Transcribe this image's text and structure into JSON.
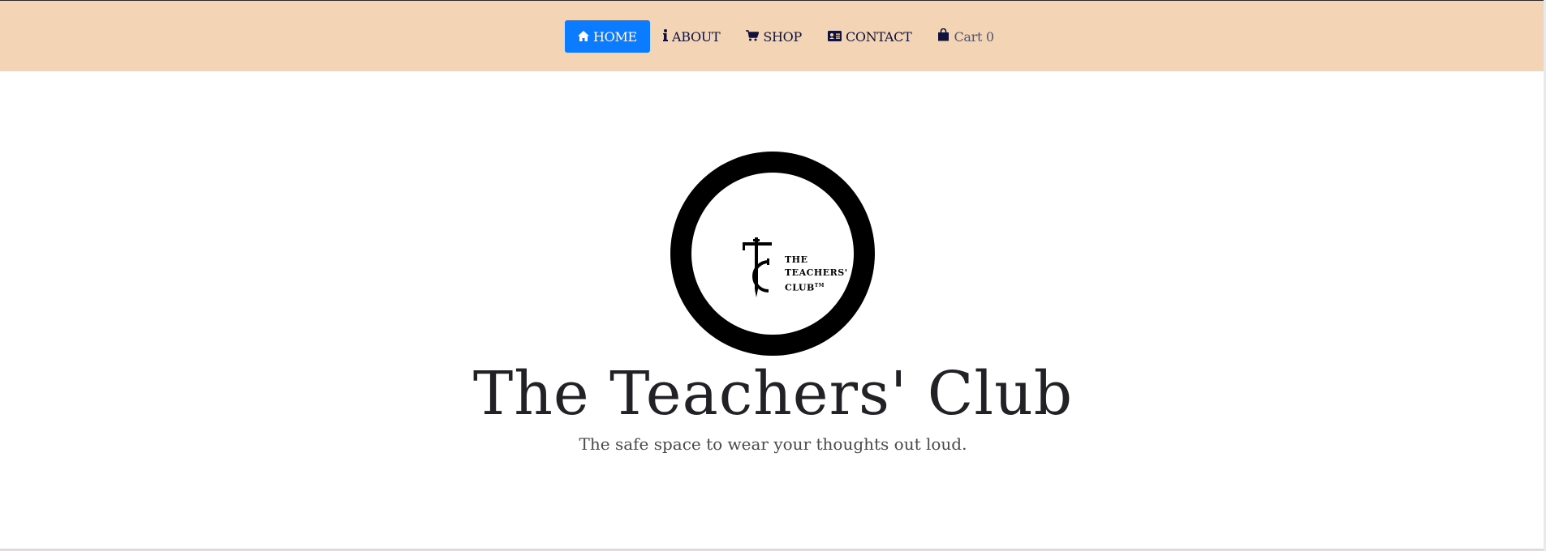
{
  "nav": {
    "items": [
      {
        "label": "HOME",
        "icon": "home-icon",
        "active": true
      },
      {
        "label": "ABOUT",
        "icon": "info-icon",
        "active": false
      },
      {
        "label": "SHOP",
        "icon": "shopping-cart-icon",
        "active": false
      },
      {
        "label": "CONTACT",
        "icon": "contact-card-icon",
        "active": false
      },
      {
        "label": "Cart 0",
        "icon": "shopping-bag-icon",
        "active": false
      }
    ]
  },
  "logo": {
    "line1": "THE",
    "line2": "TEACHERS'",
    "line3": "CLUB",
    "mark": "TM"
  },
  "hero": {
    "title": "The Teachers' Club",
    "subtitle": "The safe space to wear your thoughts out loud."
  },
  "colors": {
    "header_bg": "#f3d5b5",
    "active_nav_bg": "#0b7bff",
    "nav_text": "#11113a",
    "title_text": "#222226"
  }
}
